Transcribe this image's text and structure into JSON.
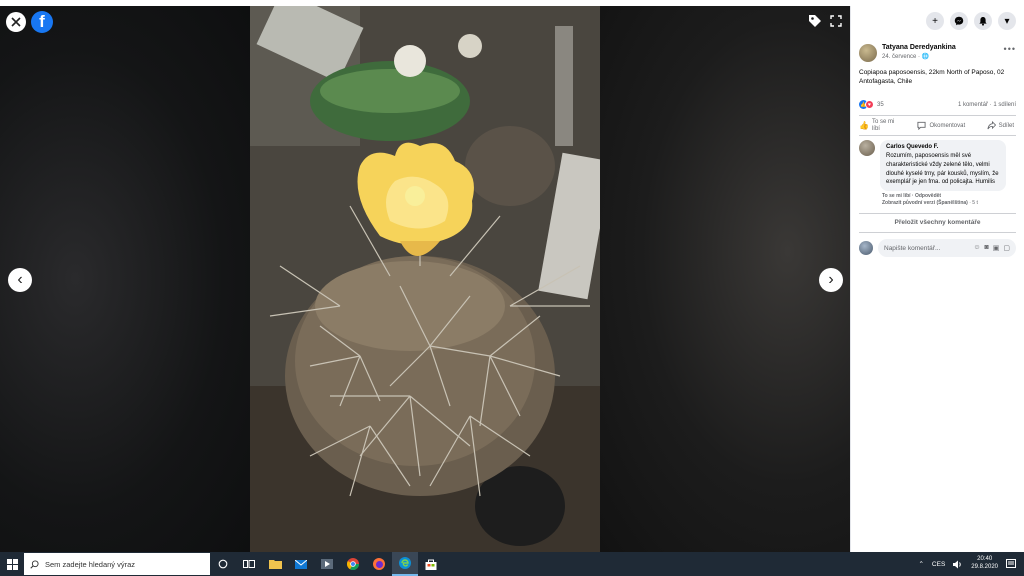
{
  "viewer": {
    "close_icon": "close-icon",
    "logo_letter": "f",
    "prev_arrow": "‹",
    "next_arrow": "›"
  },
  "panel": {
    "top_buttons": [
      "+",
      "💬",
      "🔔",
      "▾"
    ],
    "author": "Tatyana Deredyankina",
    "meta": "24. července · 🌐",
    "more": "•••",
    "post_text": "Copiapoa paposoensis, 22km North of Paposo, 02 Antofagasta, Chile",
    "reaction_count": "35",
    "stats_right": "1 komentář · 1 sdílení",
    "actions": {
      "like": "To se mi líbí",
      "comment": "Okomentovat",
      "share": "Sdílet"
    },
    "comment": {
      "name": "Carlos Quevedo F.",
      "text": "Rozumím, paposoensis měl své charakteristické vždy zelené tělo, velmi dlouhé kyselé trny, pár kousků, myslím, že exemplář je jen fma. od policajta. Humilis",
      "link_line1": "To se mi líbí · Odpovědět",
      "link_line2": "Zobrazit původní verzi (Španělština)",
      "time": "· 5 t"
    },
    "translate_all": "Přeložit všechny komentáře",
    "write_placeholder": "Napište komentář..."
  },
  "taskbar": {
    "search_placeholder": "Sem zadejte hledaný výraz",
    "language": "CES",
    "time": "20:40",
    "date": "29.8.2020"
  },
  "colors": {
    "facebook_blue": "#1877f2",
    "taskbar": "#1f2a36",
    "flower": "#f6d35a"
  }
}
